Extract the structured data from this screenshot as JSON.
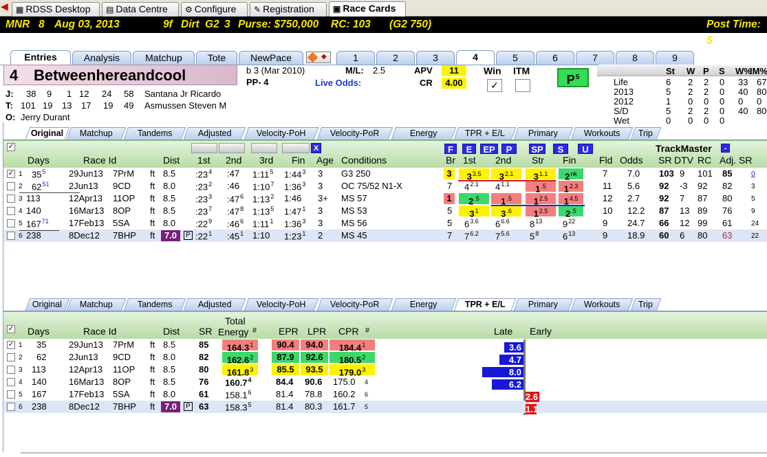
{
  "top_tabs": [
    "RDSS Desktop",
    "Data Centre",
    "Configure",
    "Registration",
    "Race Cards"
  ],
  "info": {
    "track": "MNR",
    "race": "8",
    "date": "Aug 03, 2013",
    "dist": "9f",
    "surface": "Dirt",
    "grade": "G2",
    "n": "3",
    "purse": "Purse: $750,000",
    "rc": "RC: 103",
    "rc2": "(G2 750)",
    "post": "Post Time: 5"
  },
  "race_tabs": [
    "Entries",
    "Analysis",
    "Matchup",
    "Tote",
    "NewPace",
    "1",
    "2",
    "3",
    "4",
    "5",
    "6",
    "7",
    "8",
    "9"
  ],
  "horse": {
    "num": "4",
    "name": "Betweenhereandcool",
    "sex_age": "b 3 (Mar 2010)",
    "pp": "PP- 4",
    "ml_label": "M/L:",
    "ml": "2.5",
    "live": "Live Odds:",
    "apv_label": "APV",
    "apv": "11",
    "cr_label": "CR",
    "cr": "4.00",
    "win": "Win",
    "itm": "ITM",
    "pbadge": "P",
    "pbadge_sup": "5"
  },
  "connections": {
    "j_label": "J:",
    "j_stats": [
      "38",
      "9",
      "1",
      "12",
      "24",
      "58"
    ],
    "j_name": "Santana Jr Ricardo",
    "t_label": "T:",
    "t_stats": [
      "101",
      "19",
      "13",
      "17",
      "19",
      "49"
    ],
    "t_name": "Asmussen Steven M",
    "o_label": "O:",
    "o_name": "Jerry Durant"
  },
  "record": {
    "headers": [
      "St",
      "W",
      "P",
      "S",
      "W%",
      "IM%"
    ],
    "rows": [
      [
        "Life",
        "6",
        "2",
        "2",
        "0",
        "33",
        "67"
      ],
      [
        "2013",
        "5",
        "2",
        "2",
        "0",
        "40",
        "80"
      ],
      [
        "2012",
        "1",
        "0",
        "0",
        "0",
        "0",
        "0"
      ],
      [
        "S/D",
        "5",
        "2",
        "2",
        "0",
        "40",
        "80"
      ],
      [
        "Wet",
        "0",
        "0",
        "0",
        "0",
        "",
        ""
      ]
    ]
  },
  "sub_tabs": [
    "Original",
    "Matchup",
    "Tandems",
    "Adjusted",
    "Velocity-PoH",
    "Velocity-PoR",
    "Energy",
    "TPR + E/L",
    "Primary",
    "Workouts",
    "Trip"
  ],
  "grid1": {
    "headers": {
      "days": "Days",
      "raceid": "Race Id",
      "dist": "Dist",
      "c1": "1st",
      "c2": "2nd",
      "c3": "3rd",
      "fin": "Fin",
      "age": "Age",
      "cond": "Conditions",
      "br": "Br",
      "s1": "1st",
      "s2": "2nd",
      "str": "Str",
      "sfin": "Fin",
      "fld": "Fld",
      "odds": "Odds",
      "sr": "SR",
      "dtv": "DTV",
      "rc": "RC",
      "adjsr": "Adj. SR",
      "tm": "TrackMaster",
      "minus": "-",
      "x": "X"
    },
    "letter_btns": [
      "F",
      "E",
      "EP",
      "P",
      "SP",
      "S",
      "U"
    ],
    "rows": [
      {
        "n": "1",
        "days": "35",
        "dsup": "5",
        "date": "29Jun13",
        "race": "7PrM",
        "ft": "ft",
        "dist": "8.5",
        "c1": ":23",
        "c1s": "4",
        "c2": ":47",
        "c3": "1:11",
        "c3s": "5",
        "fin": "1:44",
        "fins": "3",
        "age": "3",
        "cond": "G3 250",
        "br": "3",
        "s1": "3",
        "s1s": "3.5",
        "s2": "3",
        "s2s": "2.1",
        "str": "3",
        "strs": "1.1",
        "sf": "2",
        "sfs": "nk",
        "fld": "7",
        "odds": "7.0",
        "sr": "103",
        "dtv": "9",
        "rc": "101",
        "adj": "85",
        "adjs": "0"
      },
      {
        "n": "2",
        "days": "62",
        "dsup": "51",
        "date": "2Jun13",
        "race": "9CD",
        "ft": "ft",
        "dist": "8.0",
        "c1": ":23",
        "c1s": "2",
        "c2": ":46",
        "c3": "1:10",
        "c3s": "7",
        "fin": "1:36",
        "fins": "3",
        "age": "3",
        "cond": "OC 75/52 N1-X",
        "br": "7",
        "s1": "4",
        "s1s": "2.1",
        "s2": "4",
        "s2s": "1.1",
        "str": "1",
        "strs": ".5",
        "sf": "1",
        "sfs": "2.3",
        "fld": "11",
        "odds": "5.6",
        "sr": "92",
        "dtv": "-3",
        "rc": "92",
        "adj": "82",
        "adjs": "3"
      },
      {
        "n": "3",
        "days": "113",
        "dsup": "",
        "date": "12Apr13",
        "race": "11OP",
        "ft": "ft",
        "dist": "8.5",
        "c1": ":23",
        "c1s": "3",
        "c2": ":47",
        "c2s": "6",
        "c3": "1:13",
        "c3s": "2",
        "fin": "1:46",
        "age": "3+",
        "cond": "MS 57",
        "br": "1",
        "s1": "2",
        "s1s": ".5",
        "s2": "1",
        "s2s": ".5",
        "str": "1",
        "strs": "2.5",
        "sf": "1",
        "sfs": "4.5",
        "fld": "12",
        "odds": "2.7",
        "sr": "92",
        "dtv": "7",
        "rc": "87",
        "adj": "80",
        "adjs": "5"
      },
      {
        "n": "4",
        "days": "140",
        "dsup": "",
        "date": "16Mar13",
        "race": "8OP",
        "ft": "ft",
        "dist": "8.5",
        "c1": ":23",
        "c1s": "7",
        "c2": ":47",
        "c2s": "8",
        "c3": "1:13",
        "c3s": "5",
        "fin": "1:47",
        "fins": "1",
        "age": "3",
        "cond": "MS 53",
        "br": "5",
        "s1": "3",
        "s1s": "1",
        "s2": "3",
        "s2s": ".6",
        "str": "1",
        "strs": "2.5",
        "sf": "2",
        "sfs": ".5",
        "fld": "10",
        "odds": "12.2",
        "sr": "87",
        "dtv": "13",
        "rc": "89",
        "adj": "76",
        "adjs": "9"
      },
      {
        "n": "5",
        "days": "167",
        "dsup": "71",
        "date": "17Feb13",
        "race": "5SA",
        "ft": "ft",
        "dist": "8.0",
        "c1": ":22",
        "c1s": "9",
        "c2": ":46",
        "c2s": "6",
        "c3": "1:11",
        "c3s": "1",
        "fin": "1:36",
        "fins": "3",
        "age": "3",
        "cond": "MS 56",
        "br": "5",
        "s1": "6",
        "s1s": "3.6",
        "s2": "6",
        "s2s": "6.6",
        "str": "8",
        "strs": "13",
        "sf": "9",
        "sfs": "22",
        "fld": "9",
        "odds": "24.7",
        "sr": "66",
        "dtv": "12",
        "rc": "99",
        "adj": "61",
        "adjs": "24"
      },
      {
        "n": "6",
        "days": "238",
        "dsup": "",
        "date": "8Dec12",
        "race": "7BHP",
        "ft": "ft",
        "dist": "7.0",
        "c1": ":22",
        "c1s": "1",
        "c2": ":45",
        "c2s": "1",
        "c3": "1:10",
        "fin": "1:23",
        "fins": "1",
        "age": "2",
        "cond": "MS 45",
        "br": "7",
        "s1": "7",
        "s1s": "6.2",
        "s2": "7",
        "s2s": "5.6",
        "str": "5",
        "strs": "8",
        "sf": "6",
        "sfs": "13",
        "fld": "9",
        "odds": "18.9",
        "sr": "60",
        "dtv": "6",
        "rc": "80",
        "adj": "63",
        "adjs": "22",
        "pbox": "P"
      }
    ]
  },
  "grid2": {
    "headers": {
      "days": "Days",
      "raceid": "Race Id",
      "dist": "Dist",
      "sr": "SR",
      "total": "Total",
      "energy": "Energy",
      "hash": "#",
      "epr": "EPR",
      "lpr": "LPR",
      "cpr": "CPR",
      "hash2": "#",
      "late": "Late",
      "early": "Early"
    },
    "rows": [
      {
        "n": "1",
        "days": "35",
        "date": "29Jun13",
        "race": "7PrM",
        "ft": "ft",
        "dist": "8.5",
        "sr": "85",
        "en": "164.3",
        "ens": "1",
        "epr": "90.4",
        "lpr": "94.0",
        "cpr": "184.4",
        "cprs": "1",
        "late": "3.6",
        "early": ""
      },
      {
        "n": "2",
        "days": "62",
        "date": "2Jun13",
        "race": "9CD",
        "ft": "ft",
        "dist": "8.0",
        "sr": "82",
        "en": "162.6",
        "ens": "2",
        "epr": "87.9",
        "lpr": "92.6",
        "cpr": "180.5",
        "cprs": "2",
        "late": "4.7",
        "early": ""
      },
      {
        "n": "3",
        "days": "113",
        "date": "12Apr13",
        "race": "11OP",
        "ft": "ft",
        "dist": "8.5",
        "sr": "80",
        "en": "161.8",
        "ens": "3",
        "epr": "85.5",
        "lpr": "93.5",
        "cpr": "179.0",
        "cprs": "3",
        "late": "8.0",
        "early": ""
      },
      {
        "n": "4",
        "days": "140",
        "date": "16Mar13",
        "race": "8OP",
        "ft": "ft",
        "dist": "8.5",
        "sr": "76",
        "en": "160.7",
        "ens": "4",
        "epr": "84.4",
        "lpr": "90.6",
        "cpr": "175.0",
        "cprs": "4",
        "late": "6.2",
        "early": ""
      },
      {
        "n": "5",
        "days": "167",
        "date": "17Feb13",
        "race": "5SA",
        "ft": "ft",
        "dist": "8.0",
        "sr": "61",
        "en": "158.1",
        "ens": "6",
        "epr": "81.4",
        "lpr": "78.8",
        "cpr": "160.2",
        "cprs": "6",
        "late": "",
        "early": "2.6"
      },
      {
        "n": "6",
        "days": "238",
        "date": "8Dec12",
        "race": "7BHP",
        "ft": "ft",
        "dist": "7.0",
        "sr": "63",
        "en": "158.3",
        "ens": "5",
        "epr": "81.4",
        "lpr": "80.3",
        "cpr": "161.7",
        "cprs": "5",
        "late": "",
        "early": "1.1",
        "pbox": "P"
      }
    ]
  },
  "colors": {
    "yellow": "#fff200",
    "red": "#f47e7e",
    "green": "#3bd96b",
    "purple": "#7a1e7e",
    "blue_bar": "#1818d8",
    "red_bar": "#e41212"
  }
}
